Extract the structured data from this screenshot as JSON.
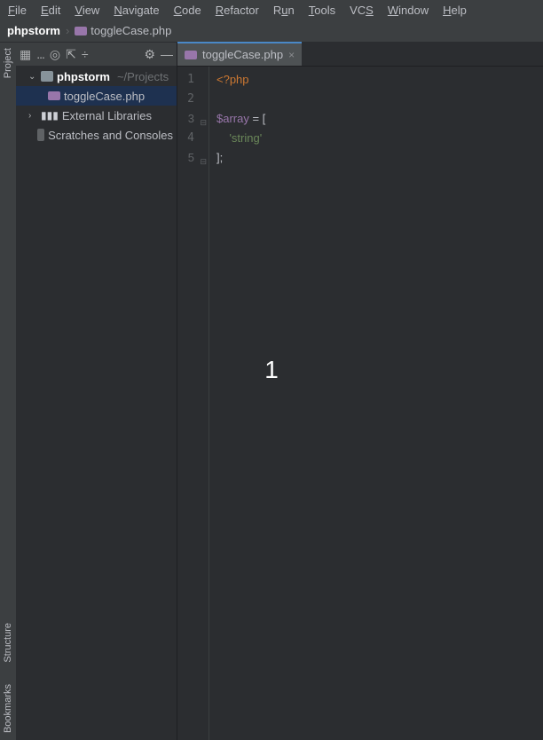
{
  "menu": {
    "file": "File",
    "edit": "Edit",
    "view": "View",
    "navigate": "Navigate",
    "code": "Code",
    "refactor": "Refactor",
    "run": "Run",
    "tools": "Tools",
    "vcs": "VCS",
    "window": "Window",
    "help": "Help"
  },
  "breadcrumb": {
    "project": "phpstorm",
    "sep": "›",
    "file": "toggleCase.php"
  },
  "project_toolbar": {
    "dots": "...",
    "target": "◎",
    "expand": "⇱",
    "collapse": "÷",
    "settings": "⚙",
    "hide": "—"
  },
  "tree": {
    "root": {
      "name": "phpstorm",
      "hint": "~/Projects"
    },
    "file": "toggleCase.php",
    "libs": "External Libraries",
    "scratches": "Scratches and Consoles"
  },
  "tabs": {
    "active": "toggleCase.php"
  },
  "gutter": {
    "l1": "1",
    "l2": "2",
    "l3": "3",
    "l4": "4",
    "l5": "5"
  },
  "code": {
    "l1": "<?php",
    "l3_var": "$array",
    "l3_rest": " = [",
    "l4": "    'string'",
    "l5": "];"
  },
  "toolwindows": {
    "project": "Project",
    "structure": "Structure",
    "bookmarks": "Bookmarks"
  },
  "overlay": "1"
}
